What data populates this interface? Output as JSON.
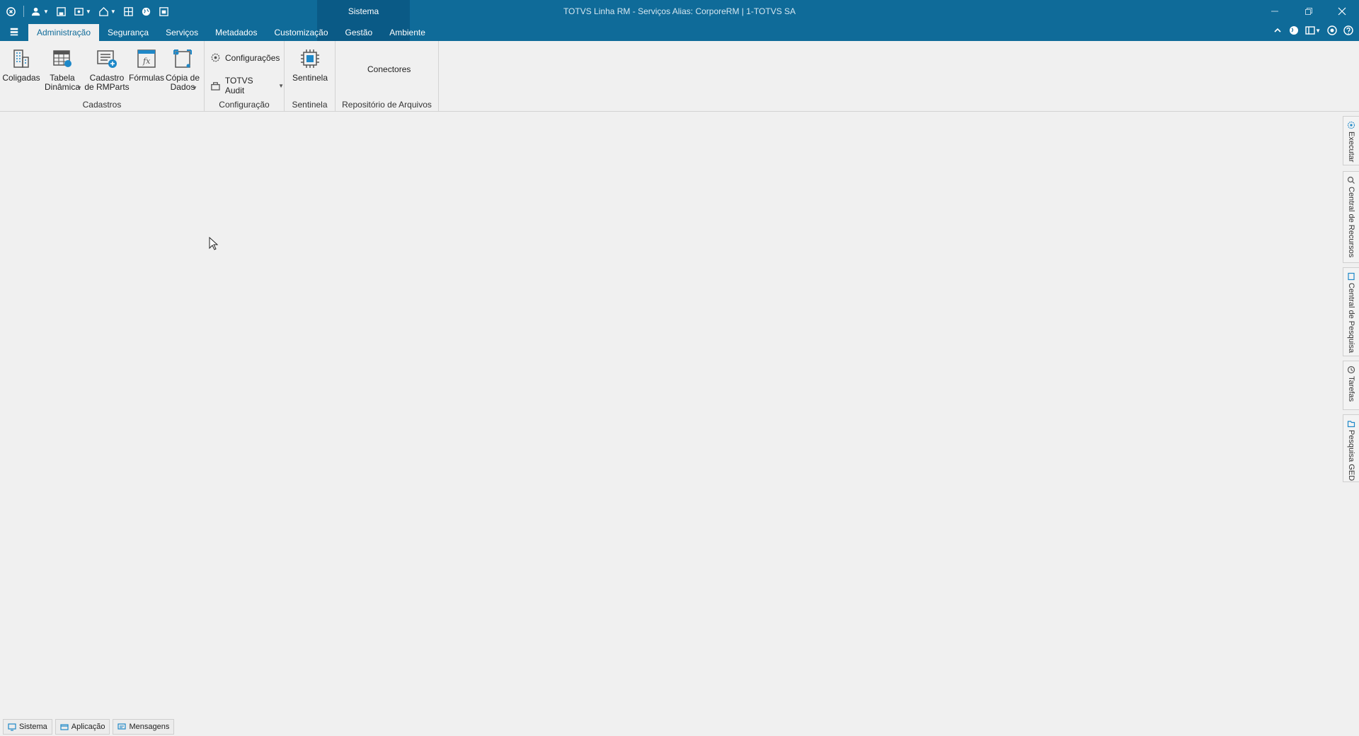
{
  "window": {
    "title": "TOTVS Linha RM - Serviços  Alias: CorporeRM | 1-TOTVS SA",
    "context_tab": "Sistema"
  },
  "quick_access": [
    "app-menu-icon",
    "user-icon",
    "save-icon",
    "config-icon",
    "home-icon",
    "grid-icon",
    "globe-icon",
    "window-icon"
  ],
  "tabs": [
    {
      "label": "Administração",
      "active": true
    },
    {
      "label": "Segurança",
      "active": false
    },
    {
      "label": "Serviços",
      "active": false
    },
    {
      "label": "Metadados",
      "active": false
    },
    {
      "label": "Customização",
      "active": false
    },
    {
      "label": "Gestão",
      "active": false
    },
    {
      "label": "Ambiente",
      "active": false
    }
  ],
  "ribbon": {
    "cadastros": {
      "label": "Cadastros",
      "coligadas": "Coligadas",
      "tabela_dinamica": "Tabela\nDinâmica",
      "cadastro_rmparts": "Cadastro\nde RMParts",
      "formulas": "Fórmulas",
      "copia_dados": "Cópia de\nDados"
    },
    "configuracao": {
      "label": "Configuração",
      "configuracoes": "Configurações",
      "totvs_audit": "TOTVS Audit"
    },
    "sentinela": {
      "label": "Sentinela",
      "sentinela": "Sentinela"
    },
    "repositorio": {
      "label": "Repositório de Arquivos",
      "conectores": "Conectores"
    }
  },
  "side_panel": [
    {
      "label": "Executar",
      "icon": "gear-icon"
    },
    {
      "label": "Central de Recursos",
      "icon": "search-icon"
    },
    {
      "label": "Central de Pesquisa",
      "icon": "document-icon"
    },
    {
      "label": "Tarefas",
      "icon": "clock-icon"
    },
    {
      "label": "Pesquisa GED",
      "icon": "folder-icon"
    }
  ],
  "status_bar": {
    "sistema": "Sistema",
    "aplicacao": "Aplicação",
    "mensagens": "Mensagens"
  },
  "colors": {
    "titlebar": "#0f6b99",
    "context_tab": "#0a5a86",
    "background": "#f0f0f0"
  }
}
